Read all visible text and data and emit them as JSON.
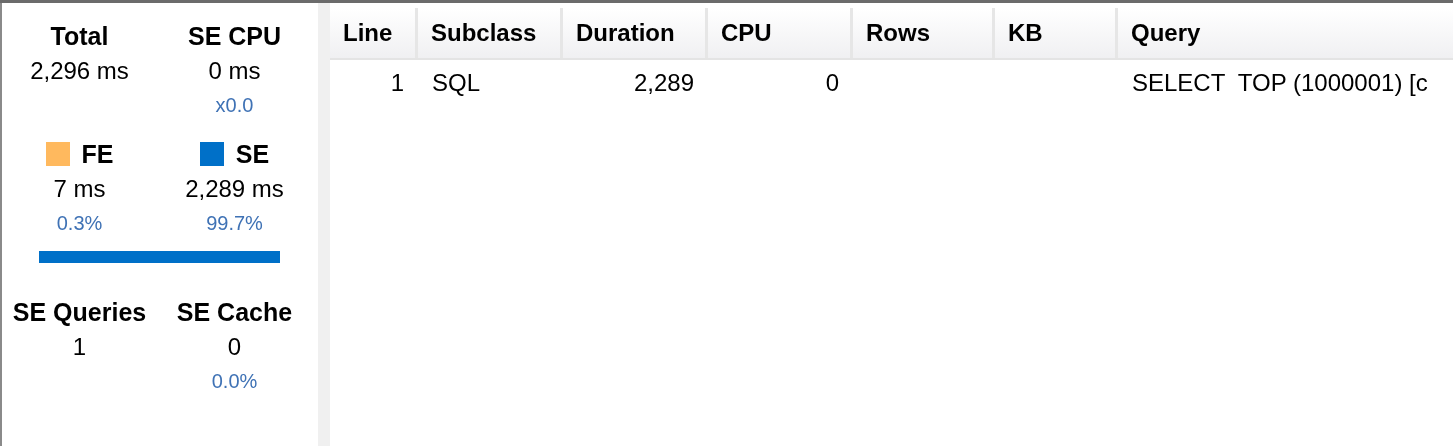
{
  "stats": [
    {
      "label": "Total",
      "value": "2,296 ms"
    },
    {
      "label": "SE CPU",
      "value": "0 ms",
      "sub": "x0.0"
    },
    {
      "label": "FE",
      "value": "7 ms",
      "sub": "0.3%",
      "color": "#ffb95e"
    },
    {
      "label": "SE",
      "value": "2,289 ms",
      "sub": "99.7%",
      "color": "#0070c8"
    },
    {
      "label": "SE Queries",
      "value": "1"
    },
    {
      "label": "SE Cache",
      "value": "0",
      "sub": "0.0%"
    }
  ],
  "table": {
    "columns": [
      "Line",
      "Subclass",
      "Duration",
      "CPU",
      "Rows",
      "KB",
      "Query"
    ],
    "rows": [
      [
        "1",
        "SQL",
        "2,289",
        "0",
        "",
        "",
        "SELECT  TOP (1000001) [c"
      ]
    ]
  }
}
